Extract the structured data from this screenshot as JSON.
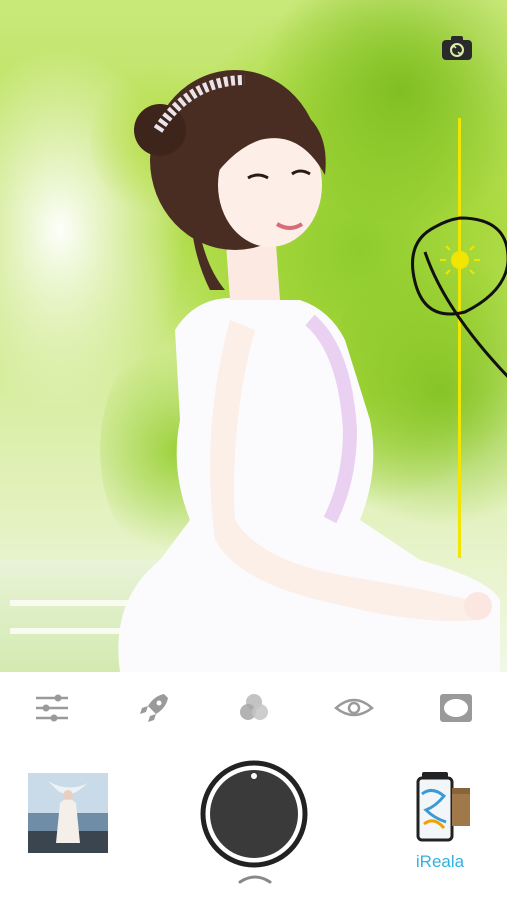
{
  "viewfinder": {
    "camera_switch_icon": "camera-switch-icon",
    "exposure_icon": "sun-icon",
    "exposure_color": "#f2e500"
  },
  "toolbar": {
    "tools": [
      {
        "name": "adjust-sliders-icon"
      },
      {
        "name": "rocket-icon"
      },
      {
        "name": "color-filter-icon"
      },
      {
        "name": "eye-icon"
      },
      {
        "name": "vignette-icon"
      }
    ]
  },
  "bottom": {
    "gallery_icon": "gallery-thumbnail",
    "shutter_icon": "shutter-button",
    "film_label": "iReala",
    "film_label_color": "#2fb3e0"
  }
}
